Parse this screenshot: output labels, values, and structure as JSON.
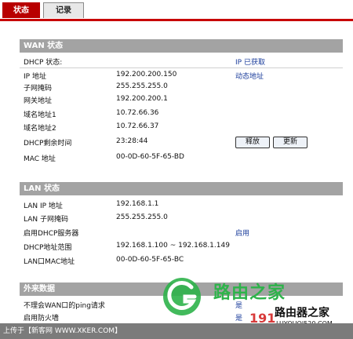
{
  "tabs": [
    {
      "label": "状态"
    },
    {
      "label": "记录"
    }
  ],
  "wan": {
    "title": "WAN 状态",
    "rows": [
      {
        "label": "DHCP 状态:",
        "value": "",
        "status": "IP 已获取"
      },
      {
        "label": "IP 地址",
        "value": "192.200.200.150",
        "status": "动态地址"
      },
      {
        "label": "子网掩码",
        "value": "255.255.255.0",
        "status": ""
      },
      {
        "label": "网关地址",
        "value": "192.200.200.1",
        "status": ""
      },
      {
        "label": "域名地址1",
        "value": "10.72.66.36",
        "status": ""
      },
      {
        "label": "域名地址2",
        "value": "10.72.66.37",
        "status": ""
      },
      {
        "label": "DHCP剩余时间",
        "value": "23:28:44",
        "status": ""
      },
      {
        "label": "MAC 地址",
        "value": "00-0D-60-5F-65-BD",
        "status": ""
      }
    ],
    "release_label": "释放",
    "renew_label": "更新"
  },
  "lan": {
    "title": "LAN 状态",
    "rows": [
      {
        "label": "LAN IP 地址",
        "value": "192.168.1.1",
        "status": ""
      },
      {
        "label": "LAN 子网掩码",
        "value": "255.255.255.0",
        "status": ""
      },
      {
        "label": "启用DHCP服务器",
        "value": "",
        "status": "启用"
      },
      {
        "label": "DHCP地址范围",
        "value": "192.168.1.100 ~ 192.168.1.149",
        "status": ""
      },
      {
        "label": "LAN口MAC地址",
        "value": "00-0D-60-5F-65-BC",
        "status": ""
      }
    ]
  },
  "external": {
    "title": "外来数据",
    "rows": [
      {
        "label": "不理会WAN口的ping请求",
        "value": "",
        "status": "是"
      },
      {
        "label": "启用防火墙",
        "value": "",
        "status": "是"
      }
    ]
  },
  "footer": {
    "text": "上传于【新客网 WWW.XKER.COM】"
  },
  "watermark": {
    "cn": "路由之家",
    "cn2": "路由器之家",
    "num": "191",
    "url": "LUYOUQI520.COM"
  },
  "colors": {
    "accent": "#b80000",
    "header_bg": "#a3a3a3",
    "status_text": "#1a3c9b",
    "watermark_green": "#2db34a",
    "watermark_red": "#d83a3a"
  }
}
